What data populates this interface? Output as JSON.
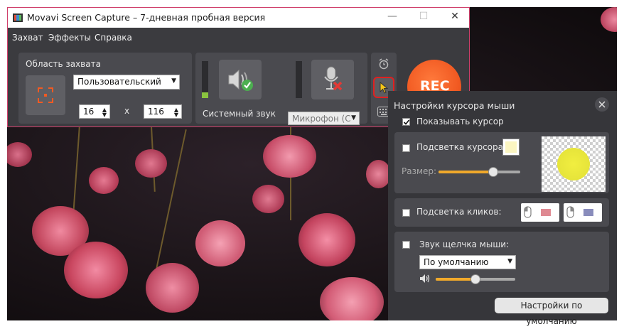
{
  "window": {
    "title": "Movavi Screen Capture – 7-дневная пробная версия",
    "minimize_glyph": "—",
    "maximize_glyph": "☐",
    "close_glyph": "✕"
  },
  "menu": {
    "items": [
      "Захват",
      "Эффекты",
      "Справка"
    ]
  },
  "capture_area": {
    "title": "Область захвата",
    "preset": "Пользовательский",
    "width": "16",
    "height": "116",
    "separator": "x"
  },
  "audio": {
    "system_sound_label": "Системный звук",
    "microphone_value": "Микрофон (С",
    "system_sound_level": 0.15
  },
  "rec_button": {
    "label": "REC"
  },
  "cursor_popup": {
    "title": "Настройки курсора мыши",
    "show_cursor_label": "Показывать курсор",
    "show_cursor_checked": true,
    "cursor_highlight_label": "Подсветка курсора:",
    "cursor_highlight_checked": false,
    "size_label": "Размер:",
    "size_value": 0.67,
    "click_highlight_label": "Подсветка кликов:",
    "click_highlight_checked": false,
    "click_sound_label": "Звук щелчка мыши:",
    "click_sound_checked": false,
    "sound_option": "По умолчанию",
    "volume_value": 0.5,
    "reset_button": "Настройки по умолчанию"
  },
  "colors": {
    "accent": "#f15a22",
    "highlight_swatch": "#fbf5c1",
    "slider_fill": "#f0a92b",
    "window_border": "#d0406b",
    "checkmark": "#4caf50",
    "mute_x": "#e53935"
  },
  "icons": [
    "movavi-logo-icon",
    "capture-area-icon",
    "speaker-icon",
    "microphone-icon",
    "alarm-clock-icon",
    "cursor-icon",
    "keyboard-icon",
    "close-icon",
    "volume-icon",
    "left-click-icon",
    "right-click-icon"
  ]
}
